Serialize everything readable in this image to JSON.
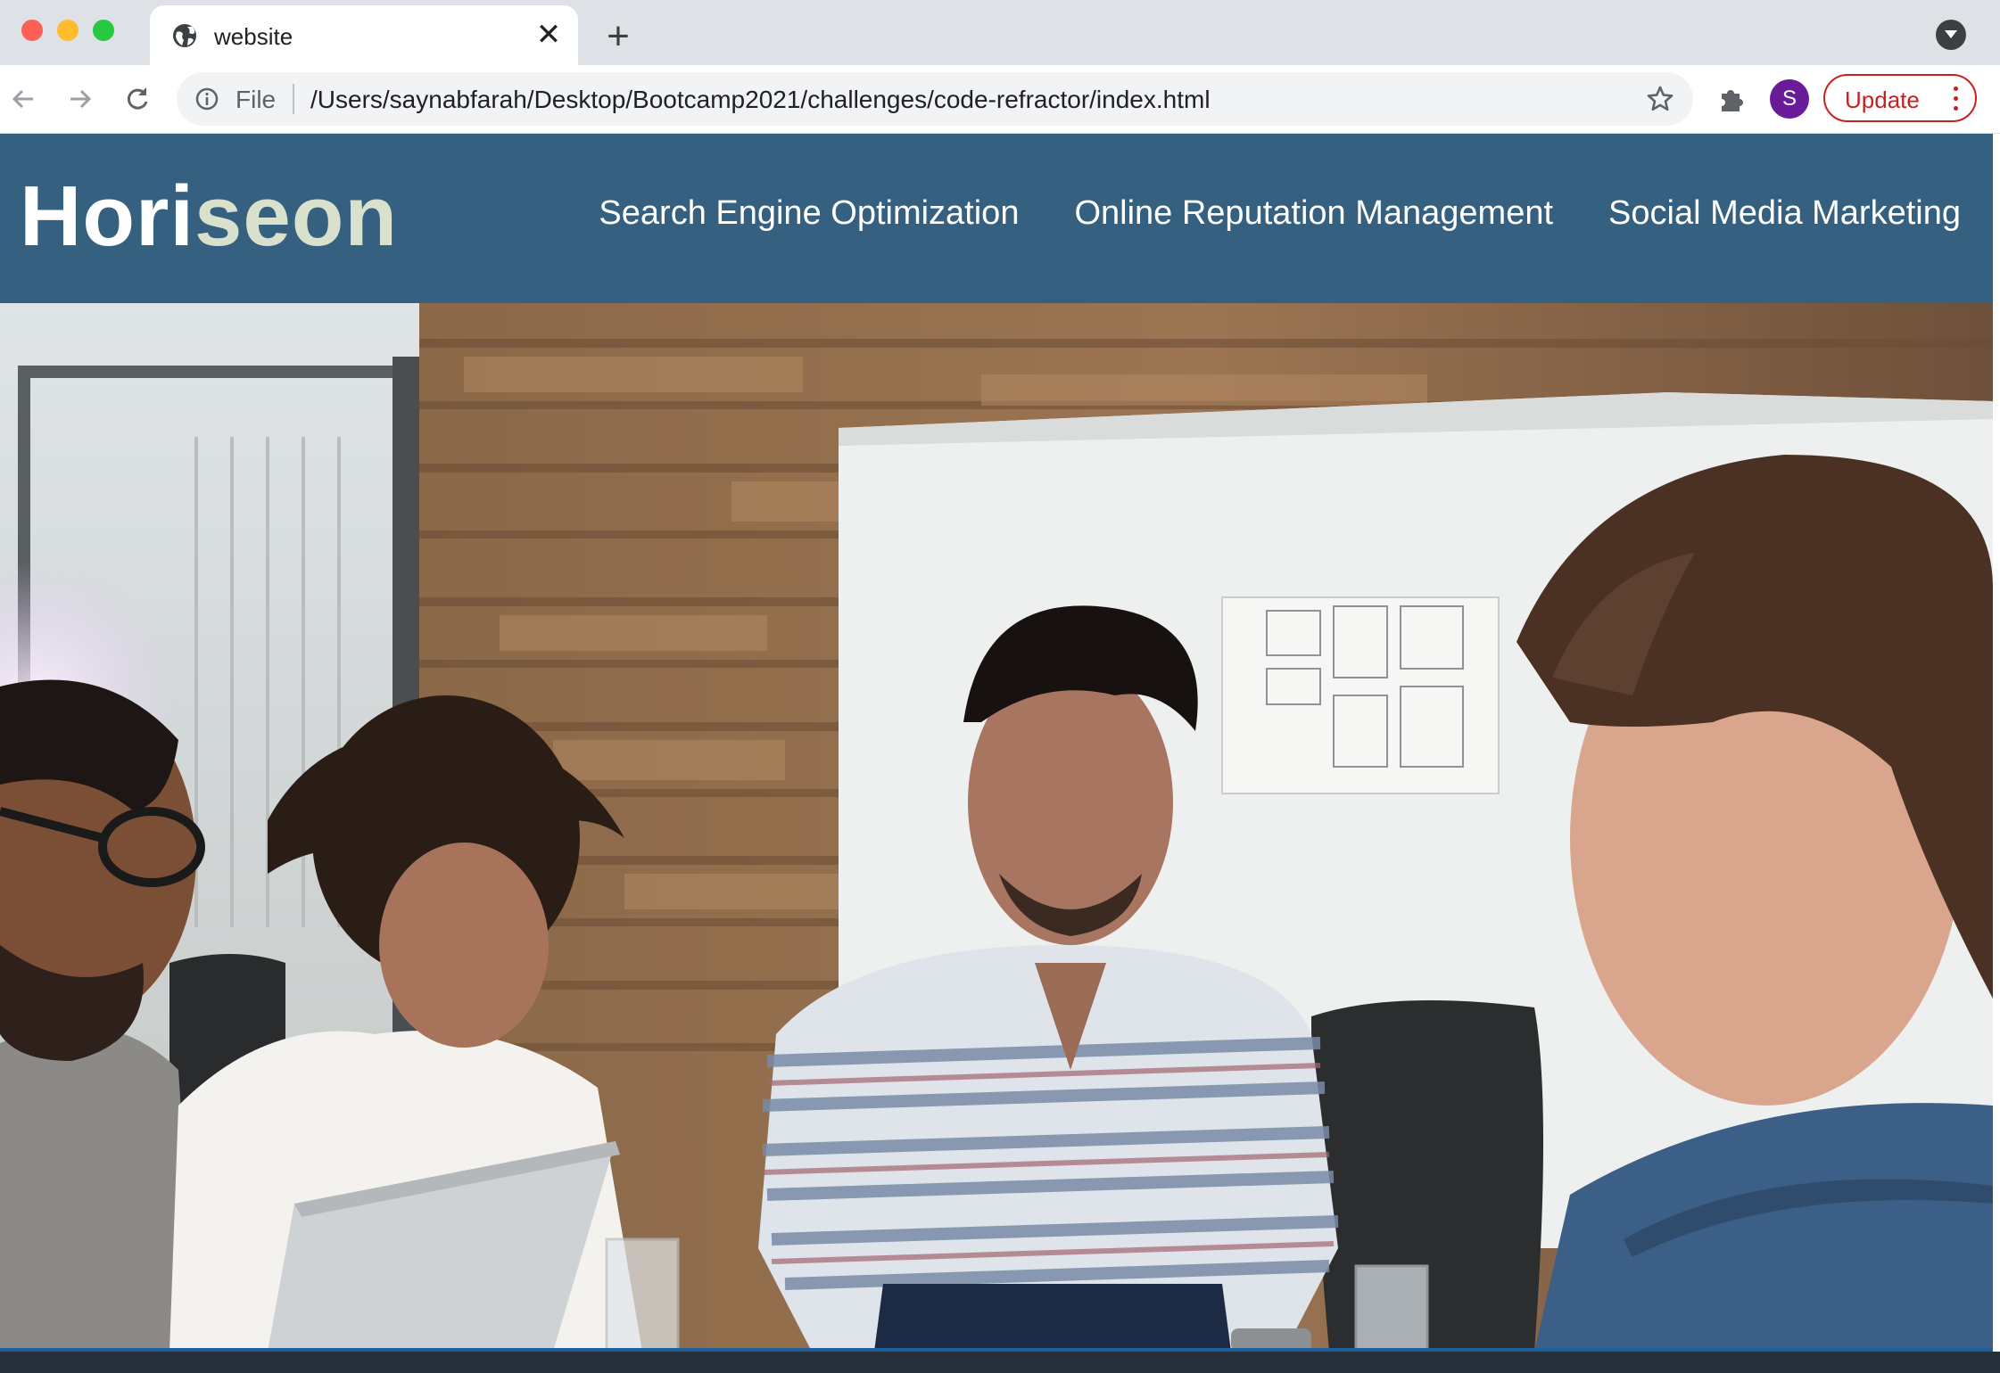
{
  "browser": {
    "tab": {
      "title": "website",
      "favicon": "globe-icon",
      "close_glyph": "✕"
    },
    "new_tab_glyph": "+",
    "toolbar": {
      "scheme_label": "File",
      "url": "/Users/saynabfarah/Desktop/Bootcamp2021/challenges/code-refractor/index.html",
      "avatar_initial": "S",
      "update_label": "Update",
      "icons": [
        "back-arrow-icon",
        "forward-arrow-icon",
        "reload-icon",
        "info-icon",
        "star-icon",
        "puzzle-icon",
        "kebab-menu-icon"
      ]
    },
    "colors": {
      "update_accent": "#c5221f",
      "avatar": "#6a1b9a",
      "tabstrip": "#dee1e6"
    }
  },
  "site": {
    "logo": {
      "part1": "Hori",
      "part2": "seon"
    },
    "nav": [
      {
        "label": "Search Engine Optimization"
      },
      {
        "label": "Online Reputation Management"
      },
      {
        "label": "Social Media Marketing"
      }
    ],
    "colors": {
      "header_bg": "#35607f",
      "logo_accent": "#d9e1cd"
    },
    "hero_image": "photo of four people working together at a meeting table"
  }
}
